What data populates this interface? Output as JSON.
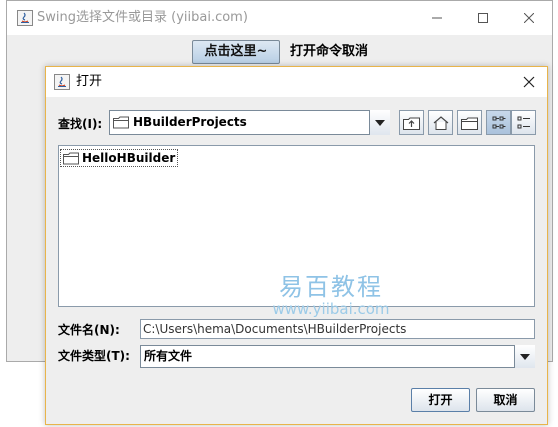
{
  "main_window": {
    "title": "Swing选择文件或目录 (yiibai.com)",
    "click_button_label": "点击这里~",
    "status_text": "打开命令取消"
  },
  "dialog": {
    "title": "打开",
    "look_in_label": "查找(I):",
    "look_in_value": "HBuilderProjects",
    "files": [
      {
        "name": "HelloHBuilder",
        "icon": "folder-icon"
      }
    ],
    "file_name_label": "文件名(N):",
    "file_name_value": "C:\\Users\\hema\\Documents\\HBuilderProjects",
    "file_type_label": "文件类型(T):",
    "file_type_value": "所有文件",
    "open_button_label": "打开",
    "cancel_button_label": "取消",
    "toolbar_icons": [
      "up-one-level-icon",
      "home-icon",
      "new-folder-icon",
      "list-view-icon",
      "details-view-icon"
    ]
  },
  "watermark": {
    "chinese": "易百教程",
    "url": "www.yiibai.com"
  },
  "colors": {
    "dialog_border": "#e8b44a",
    "button_gradient_top": "#dde8f3",
    "watermark": "#8fc3e6"
  }
}
